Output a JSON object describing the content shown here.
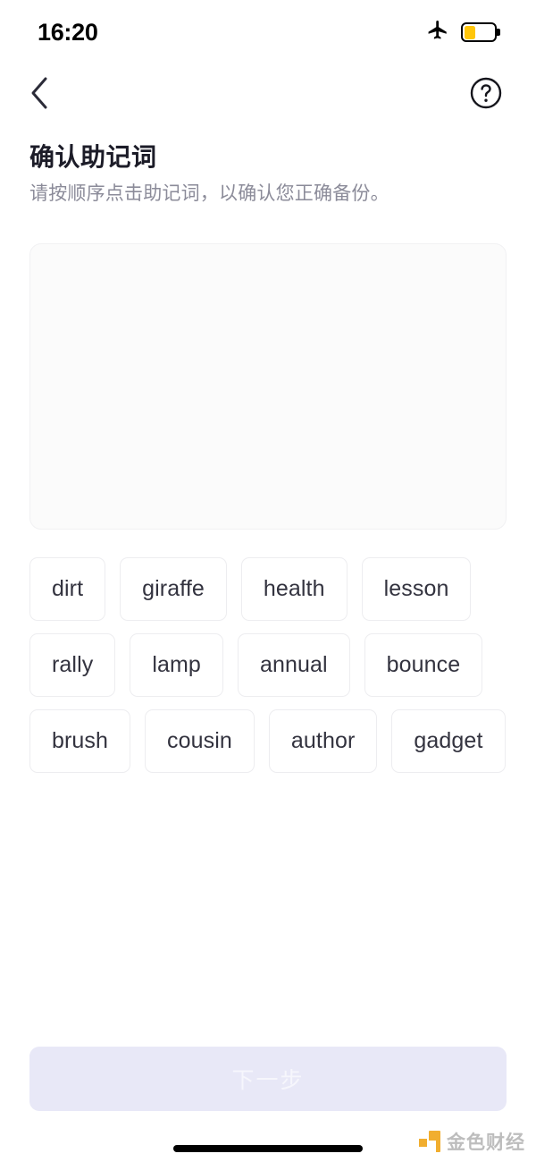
{
  "status_bar": {
    "time": "16:20",
    "airplane_icon": "airplane-icon",
    "battery_icon": "battery-icon",
    "battery_level_percent": 38,
    "battery_color": "#FFC60A"
  },
  "nav_bar": {
    "back_icon": "chevron-left-icon",
    "help_icon": "question-circle-icon"
  },
  "heading": {
    "title": "确认助记词",
    "subtitle": "请按顺序点击助记词，以确认您正确备份。"
  },
  "answer_area": {
    "selected_words": [],
    "background": "#fbfbfb"
  },
  "word_pool": {
    "words": [
      "dirt",
      "giraffe",
      "health",
      "lesson",
      "rally",
      "lamp",
      "annual",
      "bounce",
      "brush",
      "cousin",
      "author",
      "gadget"
    ]
  },
  "footer": {
    "next_label": "下一步",
    "next_enabled": false,
    "next_bg": "#e8e8f7",
    "next_text_color": "#f6f6fc"
  },
  "watermark": {
    "text": "金色财经",
    "logo_color": "#F0A81E"
  }
}
